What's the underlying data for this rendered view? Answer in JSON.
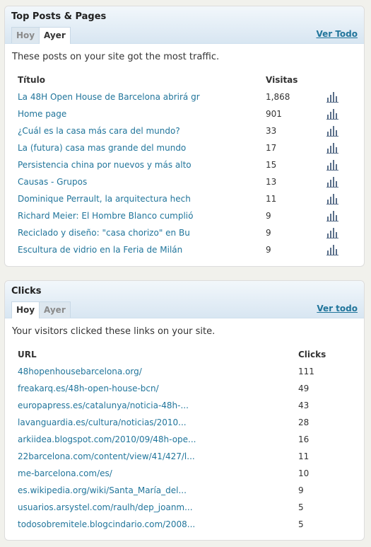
{
  "top_posts": {
    "title": "Top Posts & Pages",
    "tabs": [
      "Hoy",
      "Ayer"
    ],
    "active_tab": "Ayer",
    "view_all": "Ver Todo",
    "intro": "These posts on your site got the most traffic.",
    "col_title": "Título",
    "col_visits": "Visitas",
    "chart_icon": "bar-chart-icon",
    "rows": [
      {
        "title": "La 48H Open House de Barcelona abrirá gr",
        "visits": "1,868"
      },
      {
        "title": "Home page",
        "visits": "901"
      },
      {
        "title": "¿Cuál es la casa más cara del mundo?",
        "visits": "33"
      },
      {
        "title": "La (futura) casa mas grande del mundo",
        "visits": "17"
      },
      {
        "title": "Persistencia china por nuevos y más alto",
        "visits": "15"
      },
      {
        "title": "Causas - Grupos",
        "visits": "13"
      },
      {
        "title": "Dominique Perrault, la arquitectura hech",
        "visits": "11"
      },
      {
        "title": "Richard Meier: El Hombre Blanco cumplió",
        "visits": "9"
      },
      {
        "title": "Reciclado y diseño: \"casa chorizo\" en Bu",
        "visits": "9"
      },
      {
        "title": "Escultura de vidrio en la Feria de Milán",
        "visits": "9"
      }
    ]
  },
  "clicks": {
    "title": "Clicks",
    "tabs": [
      "Hoy",
      "Ayer"
    ],
    "active_tab": "Hoy",
    "view_all": "Ver todo",
    "intro": "Your visitors clicked these links on your site.",
    "col_url": "URL",
    "col_clicks": "Clicks",
    "rows": [
      {
        "url": "48hopenhousebarcelona.org/",
        "clicks": "111"
      },
      {
        "url": "freakarq.es/48h-open-house-bcn/",
        "clicks": "49"
      },
      {
        "url": "europapress.es/catalunya/noticia-48h-...",
        "clicks": "43"
      },
      {
        "url": "lavanguardia.es/cultura/noticias/2010...",
        "clicks": "28"
      },
      {
        "url": "arkiidea.blogspot.com/2010/09/48h-ope...",
        "clicks": "16"
      },
      {
        "url": "22barcelona.com/content/view/41/427/l...",
        "clicks": "11"
      },
      {
        "url": "me-barcelona.com/es/",
        "clicks": "10"
      },
      {
        "url": "es.wikipedia.org/wiki/Santa_María_del...",
        "clicks": "9"
      },
      {
        "url": "usuarios.arsystel.com/raulh/dep_joanm...",
        "clicks": "5"
      },
      {
        "url": "todosobremitele.blogcindario.com/2008...",
        "clicks": "5"
      }
    ]
  },
  "colors": {
    "link": "#21759b",
    "header_top": "#f2f7fb",
    "header_bottom": "#d8e6f2",
    "page_bg": "#f1f1ec"
  }
}
